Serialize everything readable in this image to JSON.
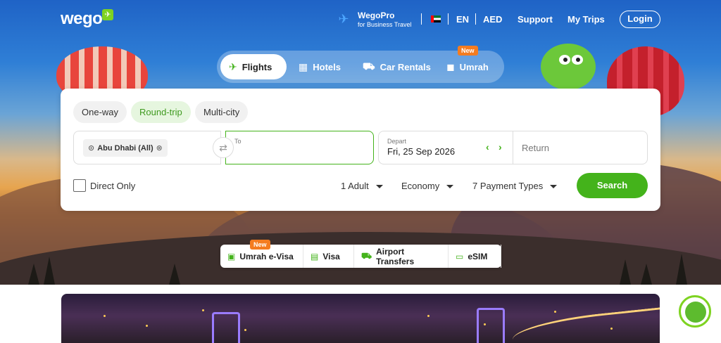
{
  "logo": {
    "text": "wego",
    "icon": "plane-icon"
  },
  "header": {
    "wegopro_title": "WegoPro",
    "wegopro_sub": "for Business Travel",
    "language": "EN",
    "currency": "AED",
    "support": "Support",
    "my_trips": "My Trips",
    "login": "Login"
  },
  "tabs": [
    {
      "label": "Flights",
      "icon": "plane-icon",
      "active": true
    },
    {
      "label": "Hotels",
      "icon": "hotel-icon"
    },
    {
      "label": "Car Rentals",
      "icon": "car-icon"
    },
    {
      "label": "Umrah",
      "icon": "kaaba-icon",
      "badge": "New"
    }
  ],
  "search": {
    "trip_types": [
      "One-way",
      "Round-trip",
      "Multi-city"
    ],
    "selected_trip": "Round-trip",
    "from_value": "Abu Dhabi (All)",
    "to_label": "To",
    "to_value": "",
    "depart_label": "Depart",
    "depart_value": "Fri, 25 Sep 2026",
    "return_placeholder": "Return",
    "direct_only": "Direct Only",
    "direct_checked": false,
    "passengers": "1 Adult",
    "cabin": "Economy",
    "payment": "7 Payment Types",
    "search_button": "Search"
  },
  "services": [
    {
      "label": "Umrah e-Visa",
      "icon": "visa-icon",
      "badge": "New"
    },
    {
      "label": "Visa",
      "icon": "passport-icon"
    },
    {
      "label": "Airport Transfers",
      "icon": "taxi-icon"
    },
    {
      "label": "eSIM",
      "icon": "esim-icon"
    }
  ],
  "colors": {
    "accent": "#44b31b",
    "badge": "#f47c20"
  }
}
